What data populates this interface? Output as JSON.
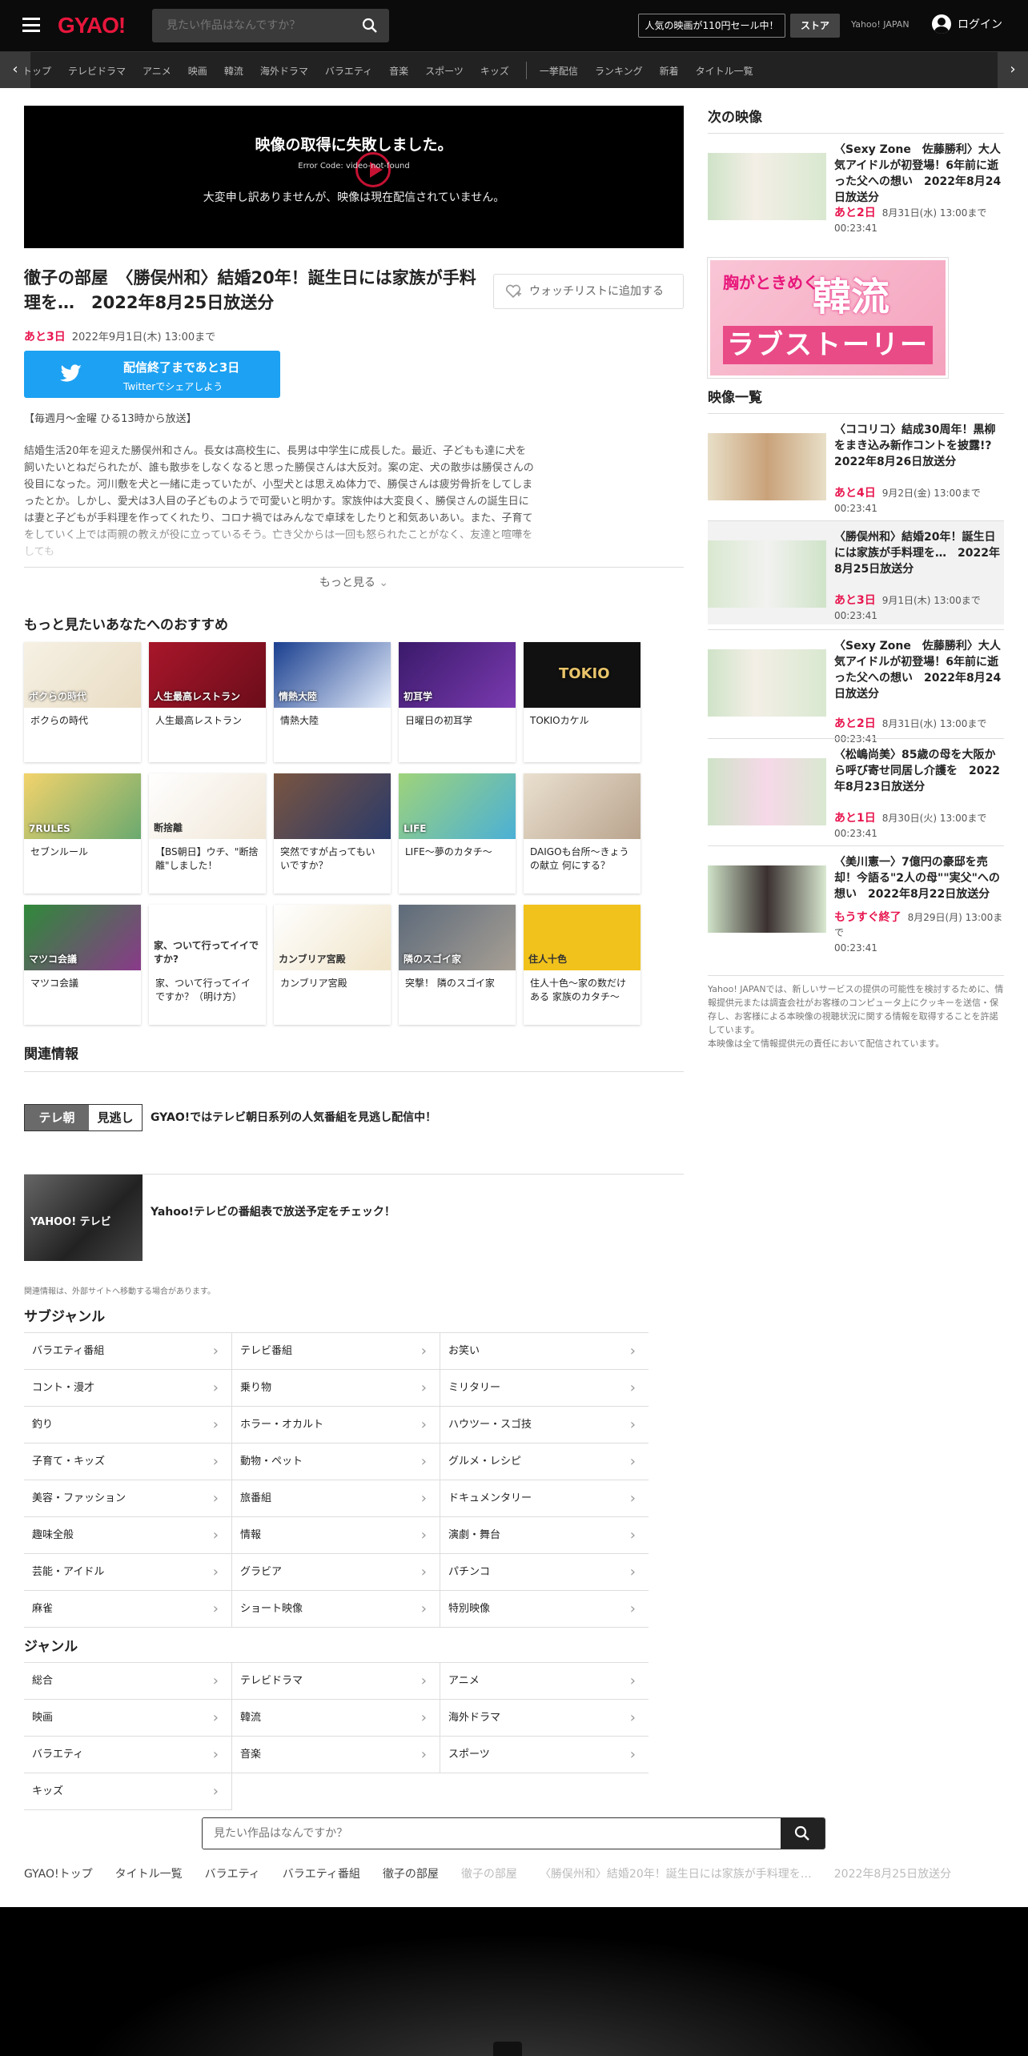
{
  "header": {
    "logo": "GYAO!",
    "search_placeholder": "見たい作品はなんですか？",
    "sale_label": "人気の映画が110円セール中！",
    "store_label": "ストア",
    "yahoo_label": "Yahoo! JAPAN",
    "login_label": "ログイン"
  },
  "nav": {
    "items": [
      "トップ",
      "テレビドラマ",
      "アニメ",
      "映画",
      "韓流",
      "海外ドラマ",
      "バラエティ",
      "音楽",
      "スポーツ",
      "キッズ"
    ],
    "items2": [
      "一挙配信",
      "ランキング",
      "新着",
      "タイトル一覧"
    ]
  },
  "player": {
    "error_title": "映像の取得に失敗しました。",
    "error_code": "Error Code: video-not-found",
    "error_message": "大変申し訳ありませんが、映像は現在配信されていません。"
  },
  "program": {
    "title": "徹子の部屋　〈勝俣州和〉結婚20年！誕生日には家族が手料理を…　2022年8月25日放送分",
    "watchlist_label": "ウォッチリストに追加する",
    "remaining": "あと3日",
    "deadline": "2022年9月1日(木) 13:00まで",
    "twitter_line1": "配信終了まであと3日",
    "twitter_line2": "Twitterでシェアしよう",
    "schedule": "【毎週月～金曜 ひる13時から放送】",
    "description": "結婚生活20年を迎えた勝俣州和さん。長女は高校生に、長男は中学生に成長した。最近、子どもも達に犬を飼いたいとねだられたが、誰も散歩をしなくなると思った勝俣さんは大反対。案の定、犬の散歩は勝俣さんの役目になった。河川敷を犬と一緒に走っていたが、小型犬とは思えぬ体力で、勝俣さんは疲労骨折をしてしまったとか。しかし、愛犬は3人目の子どものようで可愛いと明かす。家族仲は大変良く、勝俣さんの誕生日には妻と子どもが手料理を作ってくれたり、コロナ禍ではみんなで卓球をしたりと和気あいあい。また、子育てをしていく上では両親の教えが役に立っているそう。亡き父からは一回も怒られたことがなく、友達と喧嘩をしても",
    "more_label": "もっと見る"
  },
  "recommend": {
    "title": "もっと見たいあなたへのおすすめ",
    "items": [
      {
        "name": "ボクらの時代",
        "thumb": "ボクらの時代"
      },
      {
        "name": "人生最高レストラン",
        "thumb": "人生最高レストラン"
      },
      {
        "name": "情熱大陸",
        "thumb": "情熱大陸"
      },
      {
        "name": "日曜日の初耳学",
        "thumb": "初耳学"
      },
      {
        "name": "TOKIOカケル",
        "thumb": "TOKIO"
      },
      {
        "name": "セブンルール",
        "thumb": "7RULES"
      },
      {
        "name": "【BS朝日】ウチ、\"断捨離\"しました！",
        "thumb": "断捨離"
      },
      {
        "name": "突然ですが占ってもいいですか？",
        "thumb": ""
      },
      {
        "name": "LIFE～夢のカタチ～",
        "thumb": "LIFE"
      },
      {
        "name": "DAIGOも台所～きょうの献立 何にする？",
        "thumb": ""
      },
      {
        "name": "マツコ会議",
        "thumb": "マツコ会議"
      },
      {
        "name": "家、ついて行ってイイですか？（明け方）",
        "thumb": "家、ついて行ってイイですか?"
      },
      {
        "name": "カンブリア宮殿",
        "thumb": "カンブリア宮殿"
      },
      {
        "name": "突撃！ 隣のスゴイ家",
        "thumb": "隣のスゴイ家"
      },
      {
        "name": "住人十色～家の数だけある 家族のカタチ～",
        "thumb": "住人十色"
      }
    ]
  },
  "related": {
    "title": "関連情報",
    "items": [
      {
        "logo": "テレ朝 見逃し",
        "text": "GYAO!ではテレビ朝日系列の人気番組を見逃し配信中！"
      },
      {
        "logo": "YAHOO! テレビ",
        "text": "Yahoo!テレビの番組表で放送予定をチェック！"
      }
    ],
    "note": "関連情報は、外部サイトへ移動する場合があります。"
  },
  "subgenre": {
    "title": "サブジャンル",
    "items": [
      "バラエティ番組",
      "テレビ番組",
      "お笑い",
      "コント・漫才",
      "乗り物",
      "ミリタリー",
      "釣り",
      "ホラー・オカルト",
      "ハウツー・スゴ技",
      "子育て・キッズ",
      "動物・ペット",
      "グルメ・レシピ",
      "美容・ファッション",
      "旅番組",
      "ドキュメンタリー",
      "趣味全般",
      "情報",
      "演劇・舞台",
      "芸能・アイドル",
      "グラビア",
      "パチンコ",
      "麻雀",
      "ショート映像",
      "特別映像"
    ]
  },
  "genre": {
    "title": "ジャンル",
    "items": [
      "総合",
      "テレビドラマ",
      "アニメ",
      "映画",
      "韓流",
      "海外ドラマ",
      "バラエティ",
      "音楽",
      "スポーツ",
      "キッズ"
    ]
  },
  "sidebar": {
    "next_title": "次の映像",
    "next_item": {
      "title": "〈Sexy Zone　佐藤勝利〉大人気アイドルが初登場！6年前に逝った父への想い　2022年8月24日放送分",
      "remaining": "あと2日",
      "deadline": "8月31日(水) 13:00まで",
      "duration": "00:23:41"
    },
    "banner": {
      "line1": "胸がときめく",
      "line2": "韓流",
      "line3": "ラブストーリー"
    },
    "list_title": "映像一覧",
    "list": [
      {
        "title": "〈ココリコ〉結成30周年！黒柳をまき込み新作コントを披露!?　2022年8月26日放送分",
        "remaining": "あと4日",
        "deadline": "9月2日(金) 13:00まで",
        "duration": "00:23:41"
      },
      {
        "title": "〈勝俣州和〉結婚20年！誕生日には家族が手料理を…　2022年8月25日放送分",
        "remaining": "あと3日",
        "deadline": "9月1日(木) 13:00まで",
        "duration": "00:23:41"
      },
      {
        "title": "〈Sexy Zone　佐藤勝利〉大人気アイドルが初登場！6年前に逝った父への想い　2022年8月24日放送分",
        "remaining": "あと2日",
        "deadline": "8月31日(水) 13:00まで",
        "duration": "00:23:41"
      },
      {
        "title": "〈松嶋尚美〉85歳の母を大阪から呼び寄せ同居し介護を　2022年8月23日放送分",
        "remaining": "あと1日",
        "deadline": "8月30日(火) 13:00まで",
        "duration": "00:23:41"
      },
      {
        "title": "〈美川憲一〉7億円の豪邸を売却！今語る\"2人の母\"\"実父\"への想い　2022年8月22日放送分",
        "remaining": "もうすぐ終了",
        "deadline": "8月29日(月) 13:00まで",
        "duration": "00:23:41"
      }
    ],
    "note": "Yahoo! JAPANでは、新しいサービスの提供の可能性を検討するために、情報提供元または調査会社がお客様のコンピュータ上にクッキーを送信・保存し、お客様による本映像の視聴状況に関する情報を取得することを許諾しています。\n本映像は全て情報提供元の責任において配信されています。"
  },
  "bottom": {
    "search_placeholder": "見たい作品はなんですか？",
    "breadcrumb": [
      "GYAO!トップ",
      "タイトル一覧",
      "バラエティ",
      "バラエティ番組",
      "徹子の部屋"
    ],
    "breadcrumb_current": [
      "徹子の部屋",
      "〈勝俣州和〉結婚20年！誕生日には家族が手料理を…",
      "2022年8月25日放送分"
    ]
  },
  "colors": {
    "accent": "#e8164f",
    "logo": "#e8163c",
    "twitter": "#1da1f2"
  }
}
